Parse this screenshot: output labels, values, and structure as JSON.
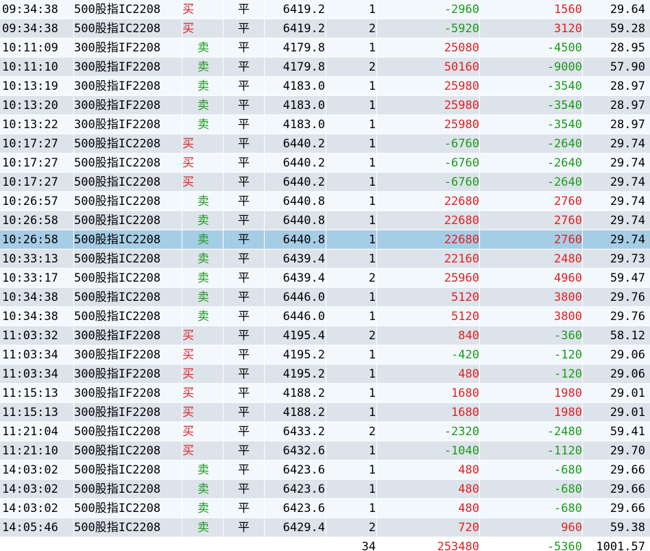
{
  "trades": [
    {
      "time": "09:34:38",
      "name": "500股指IC2208",
      "dir": "买",
      "kp": "平",
      "price": "6419.2",
      "qty": "1",
      "pnl1": "-2960",
      "pnl2": "1560",
      "fee": "29.64"
    },
    {
      "time": "09:34:38",
      "name": "500股指IC2208",
      "dir": "买",
      "kp": "平",
      "price": "6419.2",
      "qty": "2",
      "pnl1": "-5920",
      "pnl2": "3120",
      "fee": "59.28"
    },
    {
      "time": "10:11:09",
      "name": "300股指IF2208",
      "dir": "卖",
      "kp": "平",
      "price": "4179.8",
      "qty": "1",
      "pnl1": "25080",
      "pnl2": "-4500",
      "fee": "28.95"
    },
    {
      "time": "10:11:10",
      "name": "300股指IF2208",
      "dir": "卖",
      "kp": "平",
      "price": "4179.8",
      "qty": "2",
      "pnl1": "50160",
      "pnl2": "-9000",
      "fee": "57.90"
    },
    {
      "time": "10:13:19",
      "name": "300股指IF2208",
      "dir": "卖",
      "kp": "平",
      "price": "4183.0",
      "qty": "1",
      "pnl1": "25980",
      "pnl2": "-3540",
      "fee": "28.97"
    },
    {
      "time": "10:13:20",
      "name": "300股指IF2208",
      "dir": "卖",
      "kp": "平",
      "price": "4183.0",
      "qty": "1",
      "pnl1": "25980",
      "pnl2": "-3540",
      "fee": "28.97"
    },
    {
      "time": "10:13:22",
      "name": "300股指IF2208",
      "dir": "卖",
      "kp": "平",
      "price": "4183.0",
      "qty": "1",
      "pnl1": "25980",
      "pnl2": "-3540",
      "fee": "28.97"
    },
    {
      "time": "10:17:27",
      "name": "500股指IC2208",
      "dir": "买",
      "kp": "平",
      "price": "6440.2",
      "qty": "1",
      "pnl1": "-6760",
      "pnl2": "-2640",
      "fee": "29.74"
    },
    {
      "time": "10:17:27",
      "name": "500股指IC2208",
      "dir": "买",
      "kp": "平",
      "price": "6440.2",
      "qty": "1",
      "pnl1": "-6760",
      "pnl2": "-2640",
      "fee": "29.74"
    },
    {
      "time": "10:17:27",
      "name": "500股指IC2208",
      "dir": "买",
      "kp": "平",
      "price": "6440.2",
      "qty": "1",
      "pnl1": "-6760",
      "pnl2": "-2640",
      "fee": "29.74"
    },
    {
      "time": "10:26:57",
      "name": "500股指IC2208",
      "dir": "卖",
      "kp": "平",
      "price": "6440.8",
      "qty": "1",
      "pnl1": "22680",
      "pnl2": "2760",
      "fee": "29.74"
    },
    {
      "time": "10:26:58",
      "name": "500股指IC2208",
      "dir": "卖",
      "kp": "平",
      "price": "6440.8",
      "qty": "1",
      "pnl1": "22680",
      "pnl2": "2760",
      "fee": "29.74"
    },
    {
      "time": "10:26:58",
      "name": "500股指IC2208",
      "dir": "卖",
      "kp": "平",
      "price": "6440.8",
      "qty": "1",
      "pnl1": "22680",
      "pnl2": "2760",
      "fee": "29.74",
      "selected": true
    },
    {
      "time": "10:33:13",
      "name": "500股指IC2208",
      "dir": "卖",
      "kp": "平",
      "price": "6439.4",
      "qty": "1",
      "pnl1": "22160",
      "pnl2": "2480",
      "fee": "29.73"
    },
    {
      "time": "10:33:17",
      "name": "500股指IC2208",
      "dir": "卖",
      "kp": "平",
      "price": "6439.4",
      "qty": "2",
      "pnl1": "25960",
      "pnl2": "4960",
      "fee": "59.47"
    },
    {
      "time": "10:34:38",
      "name": "500股指IC2208",
      "dir": "卖",
      "kp": "平",
      "price": "6446.0",
      "qty": "1",
      "pnl1": "5120",
      "pnl2": "3800",
      "fee": "29.76"
    },
    {
      "time": "10:34:38",
      "name": "500股指IC2208",
      "dir": "卖",
      "kp": "平",
      "price": "6446.0",
      "qty": "1",
      "pnl1": "5120",
      "pnl2": "3800",
      "fee": "29.76"
    },
    {
      "time": "11:03:32",
      "name": "300股指IF2208",
      "dir": "买",
      "kp": "平",
      "price": "4195.4",
      "qty": "2",
      "pnl1": "840",
      "pnl2": "-360",
      "fee": "58.12"
    },
    {
      "time": "11:03:34",
      "name": "300股指IF2208",
      "dir": "买",
      "kp": "平",
      "price": "4195.2",
      "qty": "1",
      "pnl1": "-420",
      "pnl2": "-120",
      "fee": "29.06"
    },
    {
      "time": "11:03:34",
      "name": "300股指IF2208",
      "dir": "买",
      "kp": "平",
      "price": "4195.2",
      "qty": "1",
      "pnl1": "480",
      "pnl2": "-120",
      "fee": "29.06"
    },
    {
      "time": "11:15:13",
      "name": "300股指IF2208",
      "dir": "买",
      "kp": "平",
      "price": "4188.2",
      "qty": "1",
      "pnl1": "1680",
      "pnl2": "1980",
      "fee": "29.01"
    },
    {
      "time": "11:15:13",
      "name": "300股指IF2208",
      "dir": "买",
      "kp": "平",
      "price": "4188.2",
      "qty": "1",
      "pnl1": "1680",
      "pnl2": "1980",
      "fee": "29.01"
    },
    {
      "time": "11:21:04",
      "name": "500股指IC2208",
      "dir": "买",
      "kp": "平",
      "price": "6433.2",
      "qty": "2",
      "pnl1": "-2320",
      "pnl2": "-2480",
      "fee": "59.41"
    },
    {
      "time": "11:21:10",
      "name": "500股指IC2208",
      "dir": "买",
      "kp": "平",
      "price": "6432.6",
      "qty": "1",
      "pnl1": "-1040",
      "pnl2": "-1120",
      "fee": "29.70"
    },
    {
      "time": "14:03:02",
      "name": "500股指IC2208",
      "dir": "卖",
      "kp": "平",
      "price": "6423.6",
      "qty": "1",
      "pnl1": "480",
      "pnl2": "-680",
      "fee": "29.66"
    },
    {
      "time": "14:03:02",
      "name": "500股指IC2208",
      "dir": "卖",
      "kp": "平",
      "price": "6423.6",
      "qty": "1",
      "pnl1": "480",
      "pnl2": "-680",
      "fee": "29.66"
    },
    {
      "time": "14:03:02",
      "name": "500股指IC2208",
      "dir": "卖",
      "kp": "平",
      "price": "6423.6",
      "qty": "1",
      "pnl1": "480",
      "pnl2": "-680",
      "fee": "29.66"
    },
    {
      "time": "14:05:46",
      "name": "500股指IC2208",
      "dir": "卖",
      "kp": "平",
      "price": "6429.4",
      "qty": "2",
      "pnl1": "720",
      "pnl2": "960",
      "fee": "59.38"
    }
  ],
  "totals": {
    "qty": "34",
    "pnl1": "253480",
    "pnl2": "-5360",
    "fee": "1001.57"
  },
  "colors": {
    "positive": "#e02020",
    "negative": "#1a9a1a",
    "selected": "#a6cde6"
  }
}
